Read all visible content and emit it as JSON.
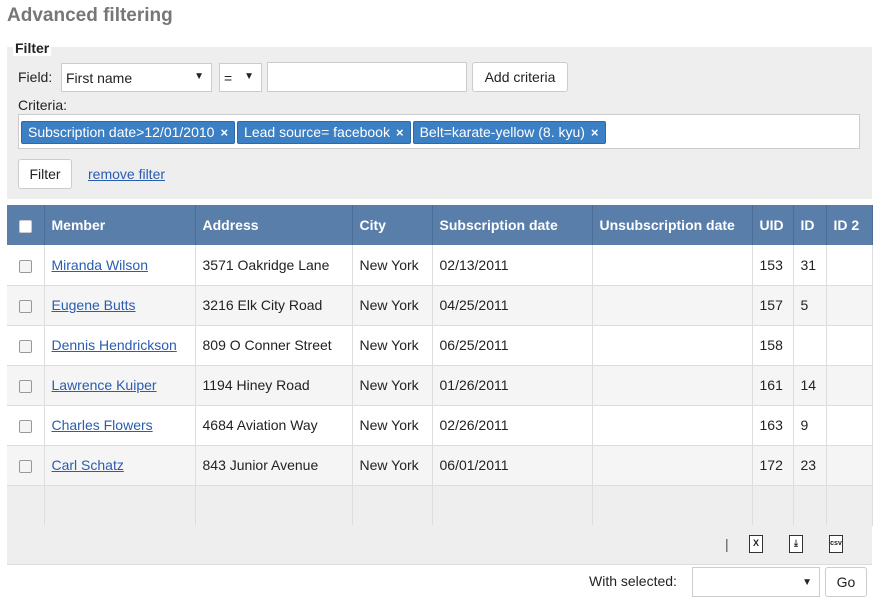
{
  "page": {
    "title": "Advanced filtering"
  },
  "filter": {
    "legend": "Filter",
    "field_label": "Field:",
    "field_select": "First name",
    "operator_select": "=",
    "value_input": "",
    "add_criteria_label": "Add criteria",
    "criteria_label": "Criteria:",
    "criteria": [
      {
        "label": "Subscription date>12/01/2010",
        "remove": "×"
      },
      {
        "label": "Lead source= facebook",
        "remove": "×"
      },
      {
        "label": "Belt=karate-yellow (8. kyu)",
        "remove": "×"
      }
    ],
    "filter_button": "Filter",
    "remove_filter_link": "remove filter"
  },
  "table": {
    "columns": [
      "Member",
      "Address",
      "City",
      "Subscription date",
      "Unsubscription date",
      "UID",
      "ID",
      "ID 2"
    ],
    "rows": [
      {
        "member": "Miranda Wilson",
        "address": "3571 Oakridge Lane",
        "city": "New York",
        "subscription": "02/13/2011",
        "unsubscription": "",
        "uid": "153",
        "id": "31",
        "id2": ""
      },
      {
        "member": "Eugene Butts",
        "address": "3216 Elk City Road",
        "city": "New York",
        "subscription": "04/25/2011",
        "unsubscription": "",
        "uid": "157",
        "id": "5",
        "id2": ""
      },
      {
        "member": "Dennis Hendrickson",
        "address": "809 O Conner Street",
        "city": "New York",
        "subscription": "06/25/2011",
        "unsubscription": "",
        "uid": "158",
        "id": "",
        "id2": ""
      },
      {
        "member": "Lawrence Kuiper",
        "address": "1194 Hiney Road",
        "city": "New York",
        "subscription": "01/26/2011",
        "unsubscription": "",
        "uid": "161",
        "id": "14",
        "id2": ""
      },
      {
        "member": "Charles Flowers",
        "address": "4684 Aviation Way",
        "city": "New York",
        "subscription": "02/26/2011",
        "unsubscription": "",
        "uid": "163",
        "id": "9",
        "id2": ""
      },
      {
        "member": "Carl Schatz",
        "address": "843 Junior Avenue",
        "city": "New York",
        "subscription": "06/01/2011",
        "unsubscription": "",
        "uid": "172",
        "id": "23",
        "id2": ""
      }
    ]
  },
  "export": {
    "separator": "|",
    "icons": [
      {
        "name": "excel-export-icon",
        "glyph": "X"
      },
      {
        "name": "pdf-export-icon",
        "glyph": "⤓"
      },
      {
        "name": "csv-export-icon",
        "glyph": "csv"
      }
    ]
  },
  "bulk": {
    "with_selected_label": "With selected:",
    "action_select": "",
    "go_button": "Go"
  },
  "colors": {
    "header_bg": "#5a7eaa",
    "chip_bg": "#3b7fc4",
    "link": "#2a5db0"
  }
}
